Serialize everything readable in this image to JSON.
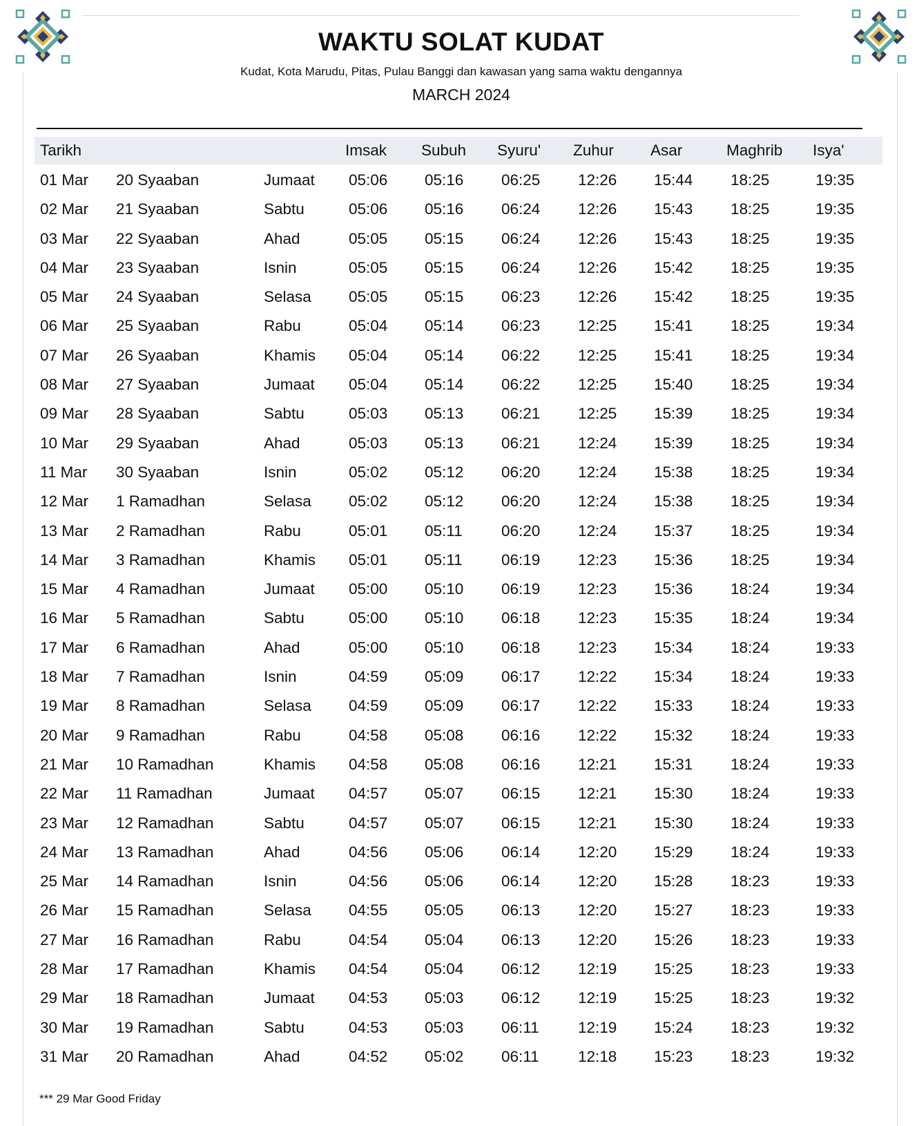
{
  "header": {
    "title": "WAKTU SOLAT KUDAT",
    "subtitle": "Kudat, Kota Marudu, Pitas, Pulau Banggi dan kawasan yang sama waktu dengannya",
    "month": "MARCH 2024"
  },
  "colors": {
    "ornament_navy": "#2b3f73",
    "ornament_teal": "#5aa8a0",
    "ornament_gold": "#e8b84a",
    "header_bg": "#e9ecf1"
  },
  "table": {
    "columns": [
      "Tarikh",
      "Imsak",
      "Subuh",
      "Syuru'",
      "Zuhur",
      "Asar",
      "Maghrib",
      "Isya'"
    ],
    "rows": [
      [
        "01 Mar",
        "20 Syaaban",
        "Jumaat",
        "05:06",
        "05:16",
        "06:25",
        "12:26",
        "15:44",
        "18:25",
        "19:35"
      ],
      [
        "02 Mar",
        "21 Syaaban",
        "Sabtu",
        "05:06",
        "05:16",
        "06:24",
        "12:26",
        "15:43",
        "18:25",
        "19:35"
      ],
      [
        "03 Mar",
        "22 Syaaban",
        "Ahad",
        "05:05",
        "05:15",
        "06:24",
        "12:26",
        "15:43",
        "18:25",
        "19:35"
      ],
      [
        "04 Mar",
        "23 Syaaban",
        "Isnin",
        "05:05",
        "05:15",
        "06:24",
        "12:26",
        "15:42",
        "18:25",
        "19:35"
      ],
      [
        "05 Mar",
        "24 Syaaban",
        "Selasa",
        "05:05",
        "05:15",
        "06:23",
        "12:26",
        "15:42",
        "18:25",
        "19:35"
      ],
      [
        "06 Mar",
        "25 Syaaban",
        "Rabu",
        "05:04",
        "05:14",
        "06:23",
        "12:25",
        "15:41",
        "18:25",
        "19:34"
      ],
      [
        "07 Mar",
        "26 Syaaban",
        "Khamis",
        "05:04",
        "05:14",
        "06:22",
        "12:25",
        "15:41",
        "18:25",
        "19:34"
      ],
      [
        "08 Mar",
        "27 Syaaban",
        "Jumaat",
        "05:04",
        "05:14",
        "06:22",
        "12:25",
        "15:40",
        "18:25",
        "19:34"
      ],
      [
        "09 Mar",
        "28 Syaaban",
        "Sabtu",
        "05:03",
        "05:13",
        "06:21",
        "12:25",
        "15:39",
        "18:25",
        "19:34"
      ],
      [
        "10 Mar",
        "29 Syaaban",
        "Ahad",
        "05:03",
        "05:13",
        "06:21",
        "12:24",
        "15:39",
        "18:25",
        "19:34"
      ],
      [
        "11 Mar",
        "30 Syaaban",
        "Isnin",
        "05:02",
        "05:12",
        "06:20",
        "12:24",
        "15:38",
        "18:25",
        "19:34"
      ],
      [
        "12 Mar",
        "1 Ramadhan",
        "Selasa",
        "05:02",
        "05:12",
        "06:20",
        "12:24",
        "15:38",
        "18:25",
        "19:34"
      ],
      [
        "13 Mar",
        "2 Ramadhan",
        "Rabu",
        "05:01",
        "05:11",
        "06:20",
        "12:24",
        "15:37",
        "18:25",
        "19:34"
      ],
      [
        "14 Mar",
        "3 Ramadhan",
        "Khamis",
        "05:01",
        "05:11",
        "06:19",
        "12:23",
        "15:36",
        "18:25",
        "19:34"
      ],
      [
        "15 Mar",
        "4 Ramadhan",
        "Jumaat",
        "05:00",
        "05:10",
        "06:19",
        "12:23",
        "15:36",
        "18:24",
        "19:34"
      ],
      [
        "16 Mar",
        "5 Ramadhan",
        "Sabtu",
        "05:00",
        "05:10",
        "06:18",
        "12:23",
        "15:35",
        "18:24",
        "19:34"
      ],
      [
        "17 Mar",
        "6 Ramadhan",
        "Ahad",
        "05:00",
        "05:10",
        "06:18",
        "12:23",
        "15:34",
        "18:24",
        "19:33"
      ],
      [
        "18 Mar",
        "7 Ramadhan",
        "Isnin",
        "04:59",
        "05:09",
        "06:17",
        "12:22",
        "15:34",
        "18:24",
        "19:33"
      ],
      [
        "19 Mar",
        "8 Ramadhan",
        "Selasa",
        "04:59",
        "05:09",
        "06:17",
        "12:22",
        "15:33",
        "18:24",
        "19:33"
      ],
      [
        "20 Mar",
        "9 Ramadhan",
        "Rabu",
        "04:58",
        "05:08",
        "06:16",
        "12:22",
        "15:32",
        "18:24",
        "19:33"
      ],
      [
        "21 Mar",
        "10 Ramadhan",
        "Khamis",
        "04:58",
        "05:08",
        "06:16",
        "12:21",
        "15:31",
        "18:24",
        "19:33"
      ],
      [
        "22 Mar",
        "11 Ramadhan",
        "Jumaat",
        "04:57",
        "05:07",
        "06:15",
        "12:21",
        "15:30",
        "18:24",
        "19:33"
      ],
      [
        "23 Mar",
        "12 Ramadhan",
        "Sabtu",
        "04:57",
        "05:07",
        "06:15",
        "12:21",
        "15:30",
        "18:24",
        "19:33"
      ],
      [
        "24 Mar",
        "13 Ramadhan",
        "Ahad",
        "04:56",
        "05:06",
        "06:14",
        "12:20",
        "15:29",
        "18:24",
        "19:33"
      ],
      [
        "25 Mar",
        "14 Ramadhan",
        "Isnin",
        "04:56",
        "05:06",
        "06:14",
        "12:20",
        "15:28",
        "18:23",
        "19:33"
      ],
      [
        "26 Mar",
        "15 Ramadhan",
        "Selasa",
        "04:55",
        "05:05",
        "06:13",
        "12:20",
        "15:27",
        "18:23",
        "19:33"
      ],
      [
        "27 Mar",
        "16 Ramadhan",
        "Rabu",
        "04:54",
        "05:04",
        "06:13",
        "12:20",
        "15:26",
        "18:23",
        "19:33"
      ],
      [
        "28 Mar",
        "17 Ramadhan",
        "Khamis",
        "04:54",
        "05:04",
        "06:12",
        "12:19",
        "15:25",
        "18:23",
        "19:33"
      ],
      [
        "29 Mar",
        "18 Ramadhan",
        "Jumaat",
        "04:53",
        "05:03",
        "06:12",
        "12:19",
        "15:25",
        "18:23",
        "19:32"
      ],
      [
        "30 Mar",
        "19 Ramadhan",
        "Sabtu",
        "04:53",
        "05:03",
        "06:11",
        "12:19",
        "15:24",
        "18:23",
        "19:32"
      ],
      [
        "31 Mar",
        "20 Ramadhan",
        "Ahad",
        "04:52",
        "05:02",
        "06:11",
        "12:18",
        "15:23",
        "18:23",
        "19:32"
      ]
    ]
  },
  "footnote": "*** 29 Mar Good Friday"
}
